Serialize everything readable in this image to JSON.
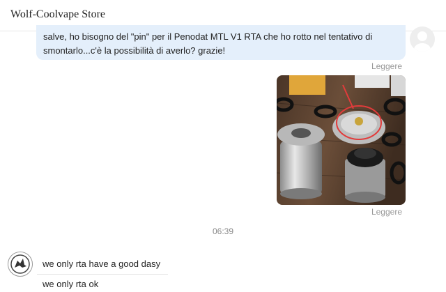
{
  "header": {
    "store_name": "Wolf-Coolvape Store"
  },
  "messages": {
    "outgoing_text": "salve, ho bisogno del \"pin\" per il Penodat MTL V1 RTA che ho rotto nel tentativo di smontarlo...c'è la possibilità di averlo? grazie!",
    "read_label_1": "Leggere",
    "read_label_2": "Leggere",
    "timestamp": "06:39",
    "incoming_1": "we only rta have a good dasy",
    "incoming_2": "we only rta ok"
  },
  "icons": {
    "user_avatar": "default-user-avatar-icon",
    "store_avatar": "wolf-logo-icon"
  },
  "colors": {
    "outgoing_bubble": "#e4effb",
    "status_text": "#999999"
  }
}
